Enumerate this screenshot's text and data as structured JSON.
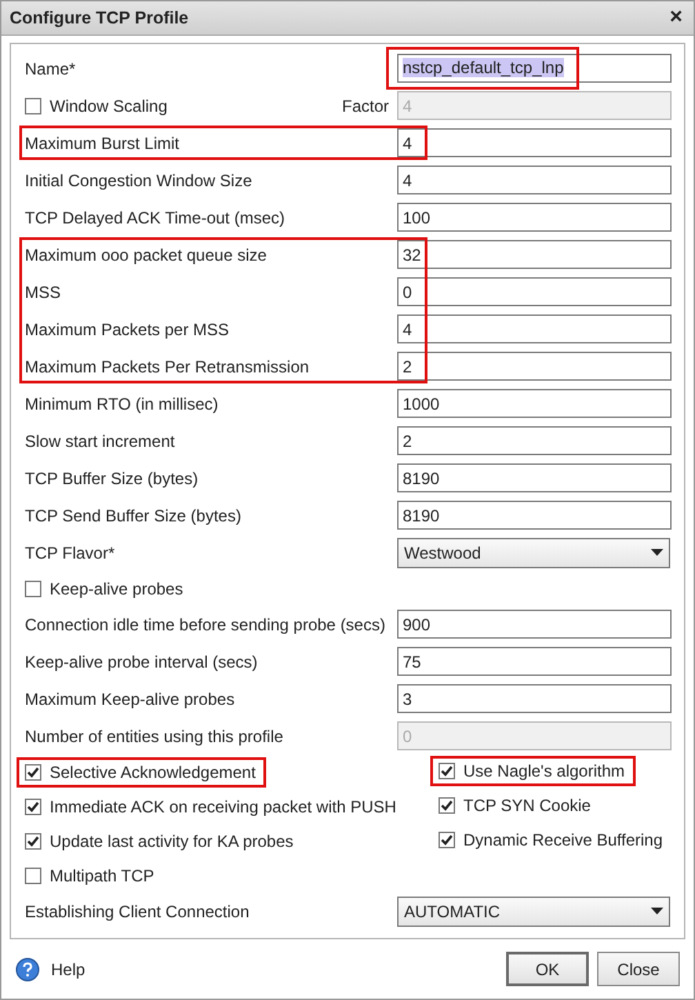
{
  "window": {
    "title": "Configure TCP Profile",
    "close": "×"
  },
  "fields": [
    {
      "kind": "text",
      "label": "Name*",
      "value": "nstcp_default_tcp_lnp",
      "disabled": false,
      "text_selected": true,
      "field_highlighted": true
    },
    {
      "kind": "checkbox-factor",
      "label": "Window Scaling",
      "checked": false,
      "factor_label": "Factor",
      "value": "4",
      "disabled": true
    },
    {
      "kind": "text",
      "label": "Maximum Burst Limit",
      "value": "4",
      "disabled": false,
      "highlighted": true
    },
    {
      "kind": "text",
      "label": "Initial Congestion Window Size",
      "value": "4",
      "disabled": false
    },
    {
      "kind": "text",
      "label": "TCP Delayed ACK Time-out (msec)",
      "value": "100",
      "disabled": false
    },
    {
      "kind": "text",
      "label": "Maximum ooo packet queue size",
      "value": "32",
      "disabled": false,
      "highlighted": true
    },
    {
      "kind": "text",
      "label": "MSS",
      "value": "0",
      "disabled": false,
      "highlighted": true
    },
    {
      "kind": "text",
      "label": "Maximum Packets per MSS",
      "value": "4",
      "disabled": false,
      "highlighted": true
    },
    {
      "kind": "text",
      "label": "Maximum Packets Per Retransmission",
      "value": "2",
      "disabled": false,
      "highlighted": true
    },
    {
      "kind": "text",
      "label": "Minimum RTO (in millisec)",
      "value": "1000",
      "disabled": false
    },
    {
      "kind": "text",
      "label": "Slow start increment",
      "value": "2",
      "disabled": false
    },
    {
      "kind": "text",
      "label": "TCP Buffer Size (bytes)",
      "value": "8190",
      "disabled": false
    },
    {
      "kind": "text",
      "label": "TCP Send Buffer Size (bytes)",
      "value": "8190",
      "disabled": false
    },
    {
      "kind": "select",
      "label": "TCP Flavor*",
      "value": "Westwood"
    },
    {
      "kind": "checkbox",
      "label": "Keep-alive probes",
      "checked": false
    },
    {
      "kind": "text",
      "label": "Connection idle time before sending probe (secs)",
      "value": "900",
      "disabled": false
    },
    {
      "kind": "text",
      "label": "Keep-alive probe interval (secs)",
      "value": "75",
      "disabled": false
    },
    {
      "kind": "text",
      "label": "Maximum Keep-alive probes",
      "value": "3",
      "disabled": false
    },
    {
      "kind": "text",
      "label": "Number of entities using this profile",
      "value": "0",
      "disabled": true
    },
    {
      "kind": "checkbox-pair",
      "left": {
        "label": "Selective Acknowledgement",
        "checked": true,
        "highlight": true
      },
      "right": {
        "label": "Use Nagle's algorithm",
        "checked": true,
        "highlight": true
      }
    },
    {
      "kind": "checkbox-pair",
      "left": {
        "label": "Immediate ACK on receiving packet with PUSH",
        "checked": true,
        "highlight": false
      },
      "right": {
        "label": "TCP SYN Cookie",
        "checked": true,
        "highlight": false
      }
    },
    {
      "kind": "checkbox-pair",
      "left": {
        "label": "Update last activity for KA probes",
        "checked": true,
        "highlight": false
      },
      "right": {
        "label": "Dynamic Receive Buffering",
        "checked": true,
        "highlight": false
      }
    },
    {
      "kind": "checkbox",
      "label": "Multipath TCP",
      "checked": false
    },
    {
      "kind": "select",
      "label": "Establishing Client Connection",
      "value": "AUTOMATIC"
    }
  ],
  "footer": {
    "help": "Help",
    "buttons": [
      {
        "label": "OK",
        "default": true
      },
      {
        "label": "Close",
        "default": false
      }
    ]
  }
}
